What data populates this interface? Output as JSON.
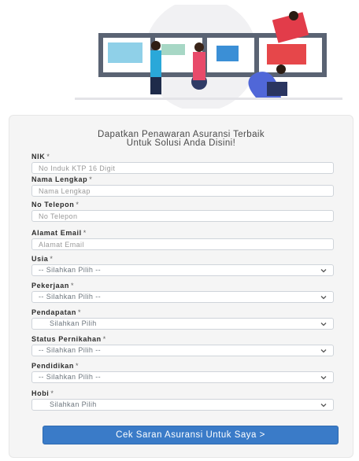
{
  "heading": {
    "line1": "Dapatkan Penawaran Asuransi Terbaik",
    "line2": "Untuk Solusi Anda Disini!"
  },
  "required_mark": "*",
  "fields": {
    "nik": {
      "label": "NIK",
      "placeholder": "No Induk KTP 16 Digit"
    },
    "nama": {
      "label": "Nama Lengkap",
      "placeholder": "Nama Lengkap"
    },
    "telepon": {
      "label": "No Telepon",
      "placeholder": "No Telepon"
    },
    "email": {
      "label": "Alamat Email",
      "placeholder": "Alamat Email"
    },
    "usia": {
      "label": "Usia",
      "selected": "-- Silahkan Pilih --"
    },
    "pekerjaan": {
      "label": "Pekerjaan",
      "selected": "-- Silahkan Pilih --"
    },
    "pendapatan": {
      "label": "Pendapatan",
      "selected": "Silahkan Pilih"
    },
    "status": {
      "label": "Status Pernikahan",
      "selected": "-- Silahkan Pilih --"
    },
    "pendidikan": {
      "label": "Pendidikan",
      "selected": "-- Silahkan Pilih --"
    },
    "hobi": {
      "label": "Hobi",
      "selected": "Silahkan Pilih"
    }
  },
  "submit_label": "Cek Saran Asuransi Untuk Saya >",
  "colors": {
    "accent": "#3a7bc8",
    "card_bg": "#f5f5f5"
  }
}
